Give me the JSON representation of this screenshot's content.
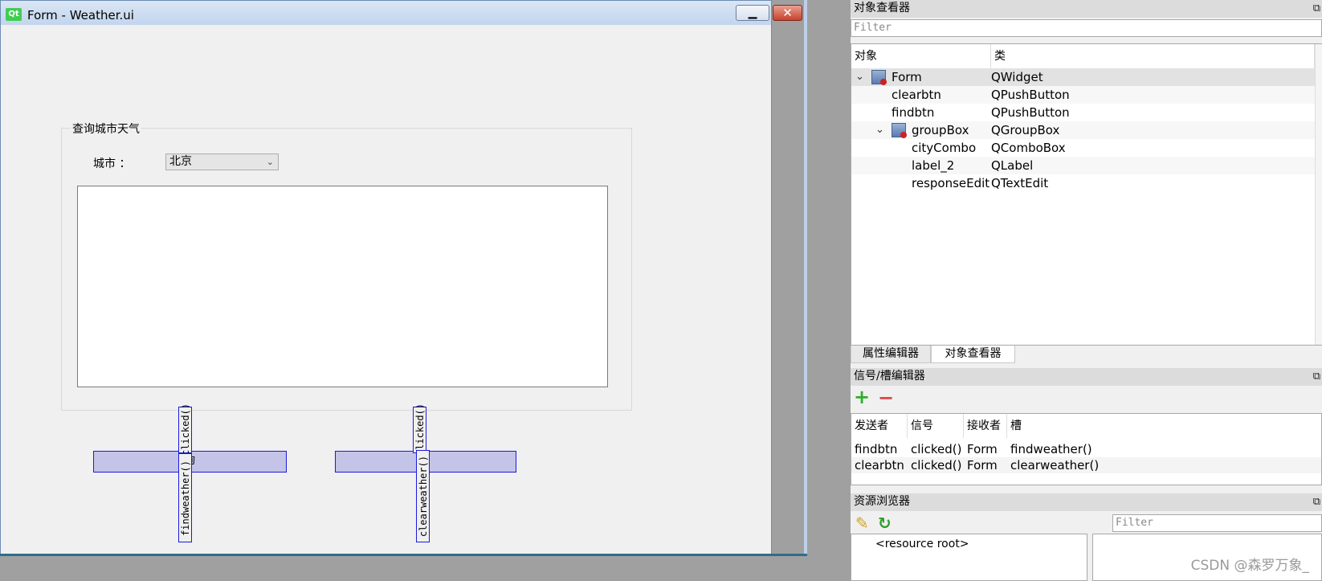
{
  "window": {
    "title": "Form - Weather.ui",
    "logo": "Qt",
    "minimize_glyph": "▁",
    "close_glyph": "✕"
  },
  "form": {
    "groupbox_title": "查询城市天气",
    "city_label": "城市 ：",
    "city_combo_value": "北京",
    "find_button_label": "询",
    "clear_button_label": "",
    "find_sig_top": "clicked()",
    "find_sig_bottom": "findweather()",
    "clear_sig_top": "clicked()",
    "clear_sig_bottom": "clearweather()"
  },
  "object_inspector": {
    "title": "对象查看器",
    "filter_placeholder": "Filter",
    "col_object": "对象",
    "col_class": "类",
    "rows": [
      {
        "name": "Form",
        "class": "QWidget"
      },
      {
        "name": "clearbtn",
        "class": "QPushButton"
      },
      {
        "name": "findbtn",
        "class": "QPushButton"
      },
      {
        "name": "groupBox",
        "class": "QGroupBox"
      },
      {
        "name": "cityCombo",
        "class": "QComboBox"
      },
      {
        "name": "label_2",
        "class": "QLabel"
      },
      {
        "name": "responseEdit",
        "class": "QTextEdit"
      }
    ],
    "tabs": [
      "属性编辑器",
      "对象查看器"
    ]
  },
  "signal_slot_editor": {
    "title": "信号/槽编辑器",
    "headers": [
      "发送者",
      "信号",
      "接收者",
      "槽"
    ],
    "rows": [
      {
        "sender": "findbtn",
        "signal": "clicked()",
        "receiver": "Form",
        "slot": "findweather()"
      },
      {
        "sender": "clearbtn",
        "signal": "clicked()",
        "receiver": "Form",
        "slot": "clearweather()"
      }
    ]
  },
  "resource_browser": {
    "title": "资源浏览器",
    "filter_placeholder": "Filter",
    "root_item": "<resource root>"
  },
  "watermark": "CSDN @森罗万象_",
  "icons": [
    "qt-logo-icon",
    "minimize-icon",
    "close-icon",
    "combo-arrow-icon",
    "chevron-down-icon",
    "widget-icon",
    "add-icon",
    "remove-icon",
    "edit-icon",
    "reload-icon",
    "float-icon",
    "dock-close-icon"
  ]
}
